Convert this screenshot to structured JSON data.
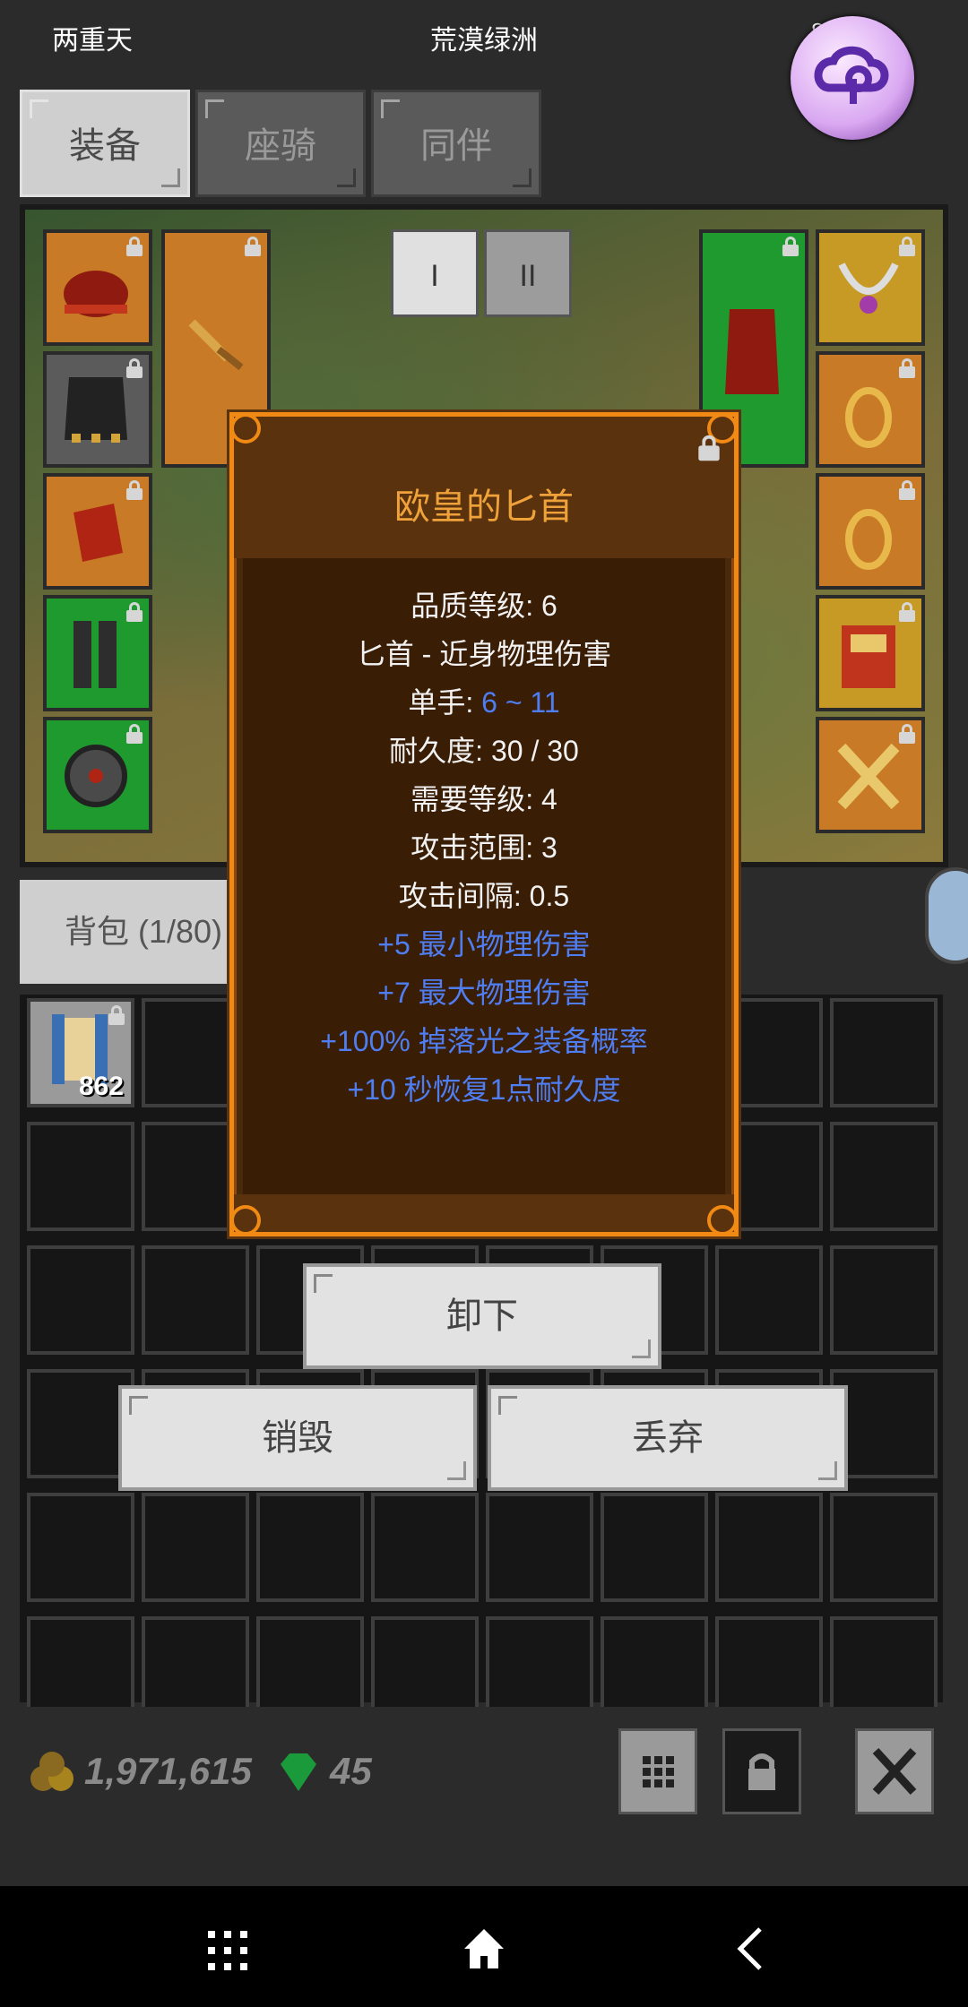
{
  "status_bar": {
    "left_text": "两重天",
    "center_text": "荒漠绿洲",
    "right_text": "8:18"
  },
  "tabs": [
    {
      "label": "装备",
      "active": true
    },
    {
      "label": "座骑",
      "active": false
    },
    {
      "label": "同伴",
      "active": false
    }
  ],
  "page_buttons": [
    {
      "label": "I",
      "active": true
    },
    {
      "label": "II",
      "active": false
    }
  ],
  "bag": {
    "tab_label": "背包 (1/80)",
    "first_item_count": "862"
  },
  "tooltip": {
    "title": "欧皇的匕首",
    "lines": [
      {
        "text": "品质等级: 6"
      },
      {
        "text": "匕首 - 近身物理伤害"
      },
      {
        "prefix": "单手: ",
        "value": "6 ~ 11"
      },
      {
        "text": "耐久度: 30 / 30"
      },
      {
        "text": "需要等级: 4"
      },
      {
        "text": "攻击范围: 3"
      },
      {
        "text": "攻击间隔: 0.5"
      },
      {
        "text": "+5 最小物理伤害"
      },
      {
        "text": "+7 最大物理伤害"
      },
      {
        "text": "+100% 掉落光之装备概率"
      },
      {
        "text": "+10 秒恢复1点耐久度"
      }
    ]
  },
  "actions": {
    "unequip": "卸下",
    "destroy": "销毁",
    "drop": "丢弃"
  },
  "currency": {
    "gold": "1,971,615",
    "gems": "45"
  },
  "colors": {
    "tooltip_title": "#f0a23a",
    "affix_blue": "#4f7ef3",
    "tooltip_border": "#f08a14"
  }
}
